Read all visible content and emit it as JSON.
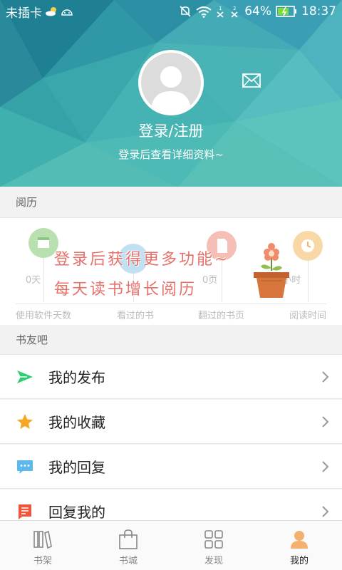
{
  "status_bar": {
    "carrier": "未插卡",
    "battery": "64%",
    "time": "18:37"
  },
  "profile": {
    "login_text": "登录/注册",
    "login_subtitle": "登录后查看详细资料~"
  },
  "history": {
    "title": "阅历",
    "stats": [
      {
        "value": "0天",
        "label": "使用软件天数",
        "color": "#a8d8a0"
      },
      {
        "value": "",
        "label": "看过的书",
        "color": "#9fd0ea"
      },
      {
        "value": "0页",
        "label": "翻过的书页",
        "color": "#f2a79e"
      },
      {
        "value": "0小时",
        "label": "阅读时间",
        "color": "#f7c98a"
      }
    ],
    "overlay_line1": "登录后获得更多功能~",
    "overlay_line2": "每天读书增长阅历"
  },
  "friends_section": {
    "title": "书友吧"
  },
  "menu": [
    {
      "label": "我的发布",
      "icon": "send-icon",
      "color": "#2ecc71"
    },
    {
      "label": "我的收藏",
      "icon": "star-icon",
      "color": "#f5a623"
    },
    {
      "label": "我的回复",
      "icon": "chat-bubble-icon",
      "color": "#5db8ec"
    },
    {
      "label": "回复我的",
      "icon": "reply-doc-icon",
      "color": "#f0543c"
    }
  ],
  "tabs": [
    {
      "label": "书架",
      "icon": "bookshelf-icon",
      "active": false
    },
    {
      "label": "书城",
      "icon": "shopping-bag-icon",
      "active": false
    },
    {
      "label": "发现",
      "icon": "grid-icon",
      "active": false
    },
    {
      "label": "我的",
      "icon": "person-icon",
      "active": true
    }
  ],
  "colors": {
    "accent": "#f0a050",
    "header": "#3aa9b0"
  }
}
